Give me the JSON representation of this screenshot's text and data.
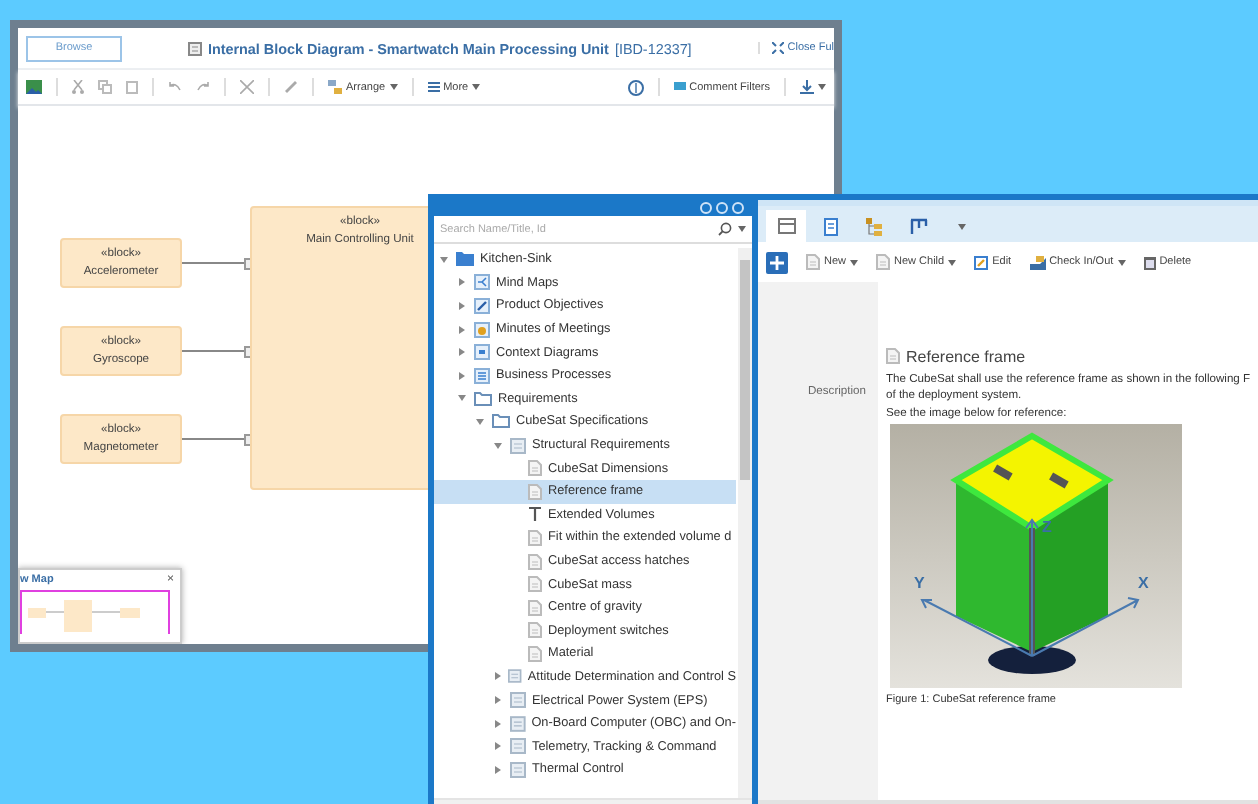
{
  "diagram_window": {
    "browse_button": "Browse",
    "title": "Internal Block Diagram - Smartwatch Main Processing Unit",
    "title_id": "[IBD-12337]",
    "close_button": "Close Ful",
    "toolbar": {
      "arrange": "Arrange",
      "more": "More",
      "comment_filters": "Comment Filters"
    },
    "blocks": [
      {
        "stereotype": "«block»",
        "name": "Accelerometer"
      },
      {
        "stereotype": "«block»",
        "name": "Gyroscope"
      },
      {
        "stereotype": "«block»",
        "name": "Magnetometer"
      }
    ],
    "main_block": {
      "stereotype": "«block»",
      "name": "Main Controlling Unit"
    },
    "overview": {
      "title": "w Map",
      "close": "×"
    }
  },
  "tree_pane": {
    "search": {
      "placeholder": "Search Name/Title, Id"
    },
    "tree": [
      {
        "label": "Kitchen-Sink",
        "kind": "root",
        "expanded": true,
        "selected": false,
        "children": [
          {
            "label": "Mind Maps",
            "kind": "mindmap",
            "expanded": false,
            "selected": false
          },
          {
            "label": "Product Objectives",
            "kind": "objective",
            "expanded": false,
            "selected": false
          },
          {
            "label": "Minutes of Meetings",
            "kind": "meeting",
            "expanded": false,
            "selected": false
          },
          {
            "label": "Context Diagrams",
            "kind": "diagram",
            "expanded": false,
            "selected": false
          },
          {
            "label": "Business Processes",
            "kind": "process",
            "expanded": false,
            "selected": false
          },
          {
            "label": "Requirements",
            "kind": "folder",
            "expanded": true,
            "selected": false,
            "children": [
              {
                "label": "CubeSat Specifications",
                "kind": "folder",
                "expanded": true,
                "selected": false,
                "children": [
                  {
                    "label": "Structural Requirements",
                    "kind": "section",
                    "expanded": true,
                    "selected": false,
                    "children": [
                      {
                        "label": "CubeSat Dimensions",
                        "kind": "document",
                        "selected": false
                      },
                      {
                        "label": "Reference frame",
                        "kind": "document",
                        "selected": true
                      },
                      {
                        "label": "Extended Volumes",
                        "kind": "text",
                        "selected": false
                      },
                      {
                        "label": "Fit within the extended volume d",
                        "kind": "document",
                        "selected": false
                      },
                      {
                        "label": "CubeSat access hatches",
                        "kind": "document",
                        "selected": false
                      },
                      {
                        "label": "CubeSat mass",
                        "kind": "document",
                        "selected": false
                      },
                      {
                        "label": "Centre of gravity",
                        "kind": "document",
                        "selected": false
                      },
                      {
                        "label": "Deployment switches",
                        "kind": "document",
                        "selected": false
                      },
                      {
                        "label": "Material",
                        "kind": "document",
                        "selected": false
                      }
                    ]
                  },
                  {
                    "label": "Attitude Determination and Control S",
                    "kind": "section",
                    "expanded": false,
                    "selected": false
                  },
                  {
                    "label": "Electrical Power System (EPS)",
                    "kind": "section",
                    "expanded": false,
                    "selected": false
                  },
                  {
                    "label": "On-Board Computer (OBC) and On-",
                    "kind": "section",
                    "expanded": false,
                    "selected": false
                  },
                  {
                    "label": "Telemetry, Tracking & Command",
                    "kind": "section",
                    "expanded": false,
                    "selected": false
                  },
                  {
                    "label": "Thermal Control",
                    "kind": "section",
                    "expanded": false,
                    "selected": false
                  }
                ]
              }
            ]
          }
        ]
      }
    ]
  },
  "detail_pane": {
    "tabs": [
      {
        "kind": "grid",
        "selected": true
      },
      {
        "kind": "document",
        "selected": false
      },
      {
        "kind": "tree",
        "selected": false
      },
      {
        "kind": "flow",
        "selected": false
      }
    ],
    "toolbar": {
      "new": "New",
      "new_child": "New Child",
      "edit": "Edit",
      "check": "Check In/Out",
      "delete": "Delete"
    },
    "heading": "Reference frame",
    "field_label": "Description",
    "description": [
      "The CubeSat shall use the reference frame as shown in the following F",
      "of the deployment system.",
      "See the image below for reference:"
    ],
    "figure": {
      "axis_labels": [
        "Z",
        "Y",
        "X"
      ],
      "caption": "Figure 1: CubeSat reference frame"
    }
  }
}
